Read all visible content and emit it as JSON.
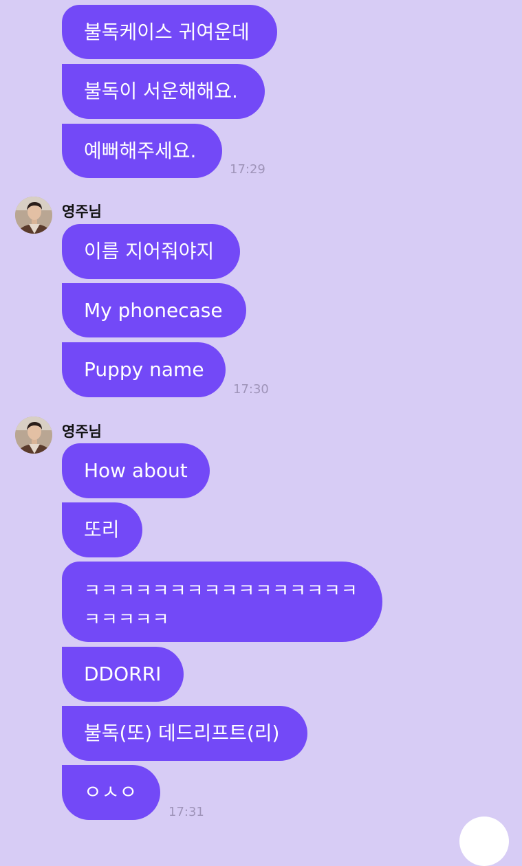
{
  "colors": {
    "background": "#d7ccf5",
    "bubble": "#7349f7",
    "bubble_text": "#ffffff",
    "timestamp": "#9f94b9"
  },
  "groups": [
    {
      "sender": "",
      "messages": [
        "불독케이스 귀여운데",
        "불독이 서운해해요.",
        "예뻐해주세요."
      ],
      "time": "17:29"
    },
    {
      "sender": "영주님",
      "avatar_icon": "profile-photo",
      "messages": [
        "이름 지어줘야지",
        "My phonecase",
        "Puppy name"
      ],
      "time": "17:30"
    },
    {
      "sender": "영주님",
      "avatar_icon": "profile-photo",
      "messages": [
        "How about",
        "또리",
        "ㅋㅋㅋㅋㅋㅋㅋㅋㅋㅋㅋㅋㅋㅋㅋㅋㅋㅋㅋㅋㅋ",
        "DDORRI",
        "불독(또) 데드리프트(리)",
        "ㅇㅅㅇ"
      ],
      "time": "17:31"
    }
  ]
}
